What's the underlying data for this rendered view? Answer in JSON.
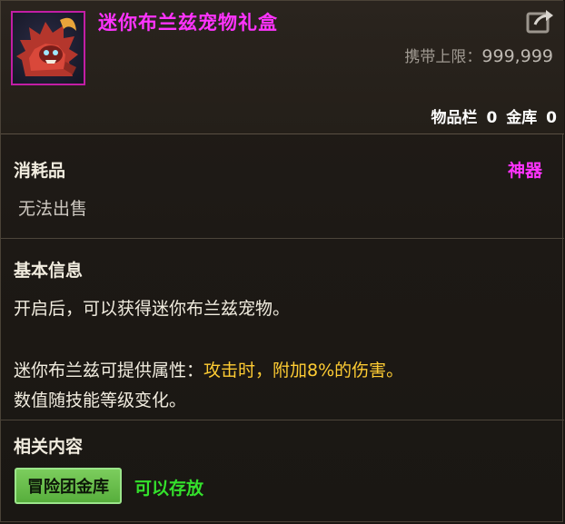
{
  "item": {
    "name": "迷你布兰兹宠物礼盒",
    "carry_limit_label": "携带上限：",
    "carry_limit_value": "999,999",
    "inventory_label": "物品栏",
    "inventory_count": "0",
    "vault_label": "金库",
    "vault_count": "0",
    "rarity_color": "#ff33ff",
    "icon": "mini-branz-pet-icon"
  },
  "category": {
    "type": "消耗品",
    "grade": "神器",
    "sell_status": "无法出售"
  },
  "basic_info": {
    "title": "基本信息",
    "line1": "开启后，可以获得迷你布兰兹宠物。",
    "line2_prefix": "迷你布兰兹可提供属性：",
    "line2_highlight": "攻击时，附加8%的伤害。",
    "line3": "数值随技能等级变化。"
  },
  "related": {
    "title": "相关内容",
    "tag_label": "冒险团金库",
    "tag_status": "可以存放"
  }
}
